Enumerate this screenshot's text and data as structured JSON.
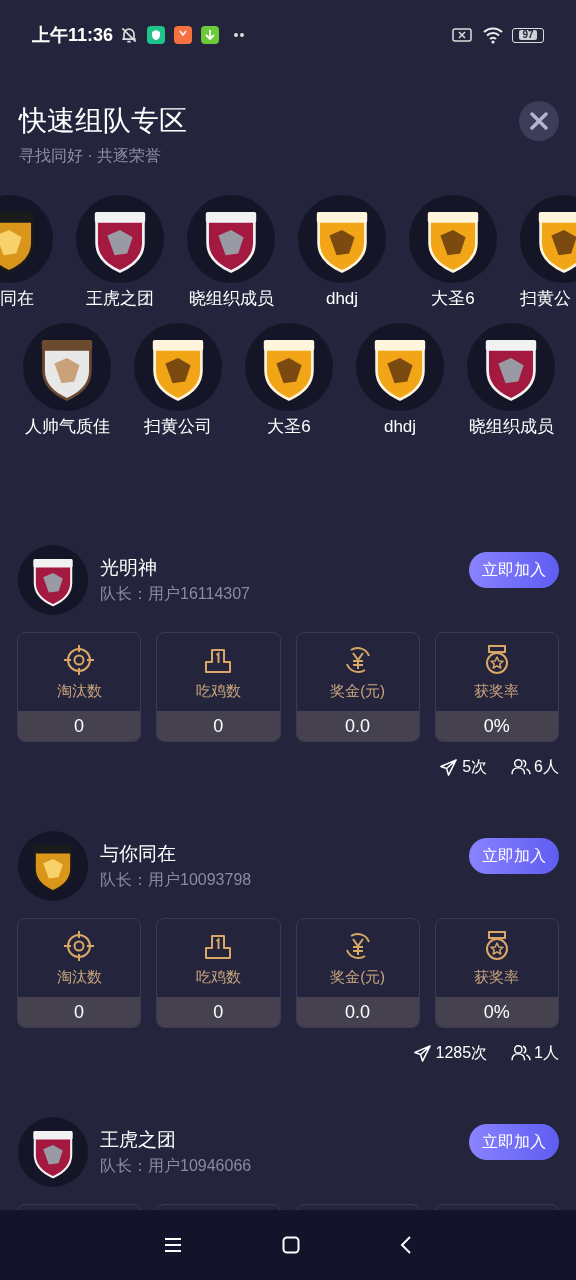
{
  "status_bar": {
    "time": "上午11:36",
    "battery": "97"
  },
  "header": {
    "title": "快速组队专区",
    "subtitle": "寻找同好 · 共逐荣誉"
  },
  "team_carousel": {
    "rows": [
      {
        "items": [
          {
            "name": "同在",
            "kind": "hornets"
          },
          {
            "name": "王虎之团",
            "kind": "wolves"
          },
          {
            "name": "晓组织成员",
            "kind": "wolves"
          },
          {
            "name": "dhdj",
            "kind": "horses"
          },
          {
            "name": "大圣6",
            "kind": "horses"
          },
          {
            "name": "扫黄公",
            "kind": "horses"
          }
        ]
      },
      {
        "items": [
          {
            "name": "人帅气质佳",
            "kind": "valhalla"
          },
          {
            "name": "扫黄公司",
            "kind": "horses"
          },
          {
            "name": "大圣6",
            "kind": "horses"
          },
          {
            "name": "dhdj",
            "kind": "horses"
          },
          {
            "name": "晓组织成员",
            "kind": "wolves"
          }
        ]
      }
    ]
  },
  "teams": [
    {
      "name": "光明神",
      "kind": "wolves",
      "captain": "队长：用户16114307",
      "join_button": "立即加入",
      "stats": [
        {
          "kind": "eliminations",
          "label": "淘汰数",
          "value": "0"
        },
        {
          "kind": "wins",
          "label": "吃鸡数",
          "value": "0"
        },
        {
          "kind": "prize",
          "label": "奖金(元)",
          "value": "0.0"
        },
        {
          "kind": "rate",
          "label": "获奖率",
          "value": "0%"
        }
      ],
      "plays": "5次",
      "members": "6人"
    },
    {
      "name": "与你同在",
      "kind": "hornets",
      "captain": "队长：用户10093798",
      "join_button": "立即加入",
      "stats": [
        {
          "kind": "eliminations",
          "label": "淘汰数",
          "value": "0"
        },
        {
          "kind": "wins",
          "label": "吃鸡数",
          "value": "0"
        },
        {
          "kind": "prize",
          "label": "奖金(元)",
          "value": "0.0"
        },
        {
          "kind": "rate",
          "label": "获奖率",
          "value": "0%"
        }
      ],
      "plays": "1285次",
      "members": "1人"
    },
    {
      "name": "王虎之团",
      "kind": "wolves",
      "captain": "队长：用户10946066",
      "join_button": "立即加入"
    }
  ]
}
